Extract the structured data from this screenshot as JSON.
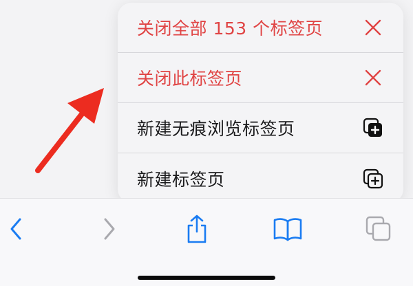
{
  "menu": {
    "items": [
      {
        "label": "关闭全部 153 个标签页",
        "icon": "close-icon",
        "style": "danger"
      },
      {
        "label": "关闭此标签页",
        "icon": "close-icon",
        "style": "danger"
      },
      {
        "label": "新建无痕浏览标签页",
        "icon": "private-tabs-icon",
        "style": "normal"
      },
      {
        "label": "新建标签页",
        "icon": "new-tab-icon",
        "style": "normal"
      }
    ]
  },
  "toolbar": {
    "buttons": [
      {
        "name": "back",
        "icon": "chevron-left-icon",
        "enabled": true
      },
      {
        "name": "forward",
        "icon": "chevron-right-icon",
        "enabled": false
      },
      {
        "name": "share",
        "icon": "share-icon",
        "enabled": true
      },
      {
        "name": "bookmarks",
        "icon": "book-icon",
        "enabled": true
      },
      {
        "name": "tabs",
        "icon": "tabs-icon",
        "enabled": false
      }
    ]
  },
  "colors": {
    "accent": "#1a7cf2",
    "danger": "#e04444",
    "disabled": "#a9a9ae",
    "annotation_arrow": "#ec2c20"
  }
}
